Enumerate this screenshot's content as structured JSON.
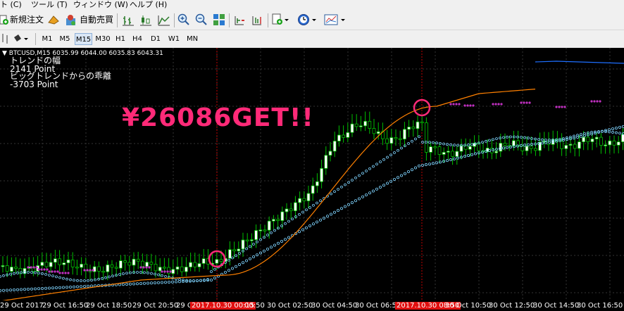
{
  "menu": [
    "ト (C)",
    "ツール (T)",
    "ウィンドウ (W)",
    "ヘルプ (H)"
  ],
  "toolbar": {
    "new_order": "新規注文",
    "auto_trade": "自動売買"
  },
  "timeframes": [
    "M1",
    "M5",
    "M15",
    "M30",
    "H1",
    "H4",
    "D1",
    "W1",
    "MN"
  ],
  "active_timeframe": "M15",
  "chart": {
    "symbol_line": "▼ BTCUSD,M15  6035.99 6044.00 6035.83 6043.31",
    "info": [
      "トレンドの幅",
      "2141 Point",
      "ビッグトレンドからの乖離",
      "-3703 Point"
    ],
    "promo": "¥26086GET!!",
    "colors": {
      "background": "#000000",
      "bull_candle": "#ffffff",
      "bear_candle": "#000000",
      "wick": "#00c000",
      "trend_line": "#ff8000",
      "trend_line_tail": "#1e6fff",
      "dots_dn": "#7fd4ff",
      "dots_up": "#c030c0",
      "circle": "#ff2a78",
      "vline": "#c00000"
    }
  },
  "time_axis": [
    {
      "label": "29 Oct 2017"
    },
    {
      "label": "29 Oct 16:50"
    },
    {
      "label": "29 Oct 18:50"
    },
    {
      "label": "29 Oct 20:50"
    },
    {
      "label": "29 O"
    },
    {
      "label": "2017.10.30 00:15",
      "highlight": true
    },
    {
      "label": "00:50"
    },
    {
      "label": "30 Oct 02:50"
    },
    {
      "label": "30 Oct 04:50"
    },
    {
      "label": "30 Oct 06:50"
    },
    {
      "label": "2017.10.30 08:50",
      "highlight": true
    },
    {
      "label": "30 Oct 10:50"
    },
    {
      "label": "30 Oct 12:50"
    },
    {
      "label": "30 Oct 14:50"
    },
    {
      "label": "30 Oct 16:50"
    }
  ]
}
